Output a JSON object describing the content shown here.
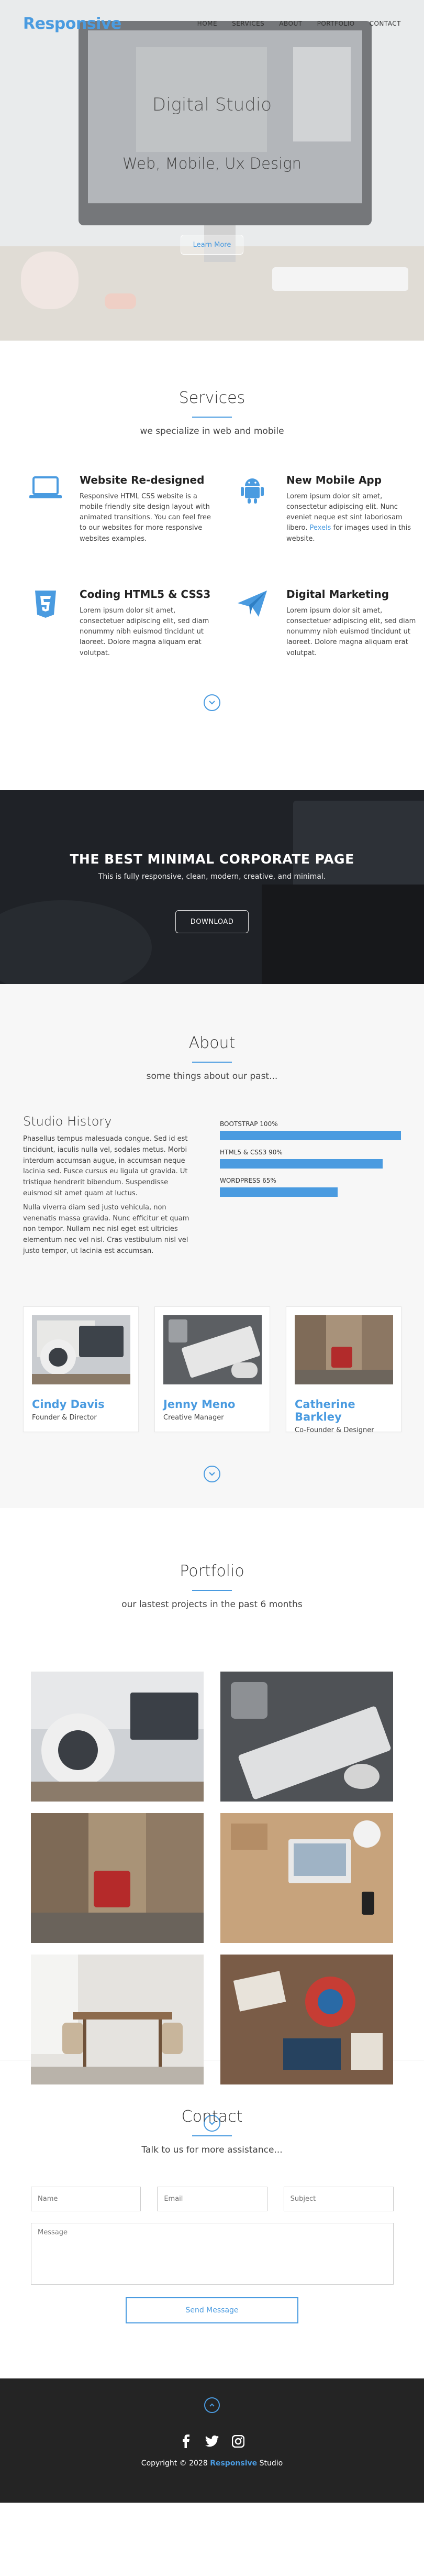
{
  "brand": "Responsive",
  "nav": [
    "HOME",
    "SERVICES",
    "ABOUT",
    "PORTFOLIO",
    "CONTACT"
  ],
  "hero": {
    "title": "Digital Studio",
    "subtitle": "Web, Mobile, Ux Design",
    "button": "Learn More"
  },
  "services": {
    "title": "Services",
    "subtitle": "we specialize in web and mobile",
    "items": [
      {
        "icon": "laptop-icon",
        "title": "Website Re-designed",
        "text": "Responsive HTML CSS website is a mobile friendly site design layout with animated transitions. You can feel free to our websites for more responsive websites examples."
      },
      {
        "icon": "android-icon",
        "title": "New Mobile App",
        "text_before": "Lorem ipsum dolor sit amet, consectetur adipiscing elit. Nunc eveniet neque est sint laboriosam libero.",
        "link": "Pexels",
        "text_after": "for images used in this website."
      },
      {
        "icon": "html5-icon",
        "title": "Coding HTML5 & CSS3",
        "text": "Lorem ipsum dolor sit amet, consectetuer adipiscing elit, sed diam nonummy nibh euismod tincidunt ut laoreet. Dolore magna aliquam erat volutpat."
      },
      {
        "icon": "paper-plane-icon",
        "title": "Digital Marketing",
        "text": "Lorem ipsum dolor sit amet, consectetuer adipiscing elit, sed diam nonummy nibh euismod tincidunt ut laoreet. Dolore magna aliquam erat volutpat."
      }
    ]
  },
  "banner": {
    "title": "THE BEST MINIMAL CORPORATE PAGE",
    "subtitle": "This is fully responsive, clean, modern, creative, and minimal.",
    "button": "DOWNLOAD"
  },
  "about": {
    "title": "About",
    "subtitle": "some things about our past...",
    "history_title": "Studio History",
    "history_p1": "Phasellus tempus malesuada congue. Sed id est tincidunt, iaculis nulla vel, sodales metus. Morbi interdum accumsan augue, in accumsan neque lacinia sed. Fusce cursus eu ligula ut gravida. Ut tristique hendrerit bibendum. Suspendisse euismod sit amet quam at luctus.",
    "history_p2": "Nulla viverra diam sed justo vehicula, non venenatis massa gravida. Nunc efficitur et quam non tempor. Nullam nec nisl eget est ultricies elementum nec vel nisl. Cras vestibulum nisl vel justo tempor, ut lacinia est accumsan.",
    "skills": [
      {
        "label": "BOOTSTRAP 100%",
        "value": 100
      },
      {
        "label": "HTML5 & CSS3 90%",
        "value": 90
      },
      {
        "label": "WORDPRESS 65%",
        "value": 65
      }
    ],
    "team": [
      {
        "name": "Cindy Davis",
        "role": "Founder & Director"
      },
      {
        "name": "Jenny Meno",
        "role": "Creative Manager"
      },
      {
        "name": "Catherine Barkley",
        "role": "Co-Founder & Designer"
      }
    ]
  },
  "portfolio": {
    "title": "Portfolio",
    "subtitle": "our lastest projects in the past 6 months"
  },
  "contact": {
    "title": "Contact",
    "subtitle": "Talk to us for more assistance...",
    "name_placeholder": "Name",
    "email_placeholder": "Email",
    "subject_placeholder": "Subject",
    "message_placeholder": "Message",
    "send": "Send Message"
  },
  "footer": {
    "copy_prefix": "Copyright © 2028",
    "copy_brand": "Responsive",
    "copy_suffix": "Studio"
  },
  "colors": {
    "accent": "#4a9be0",
    "footer_bg": "#242424"
  }
}
